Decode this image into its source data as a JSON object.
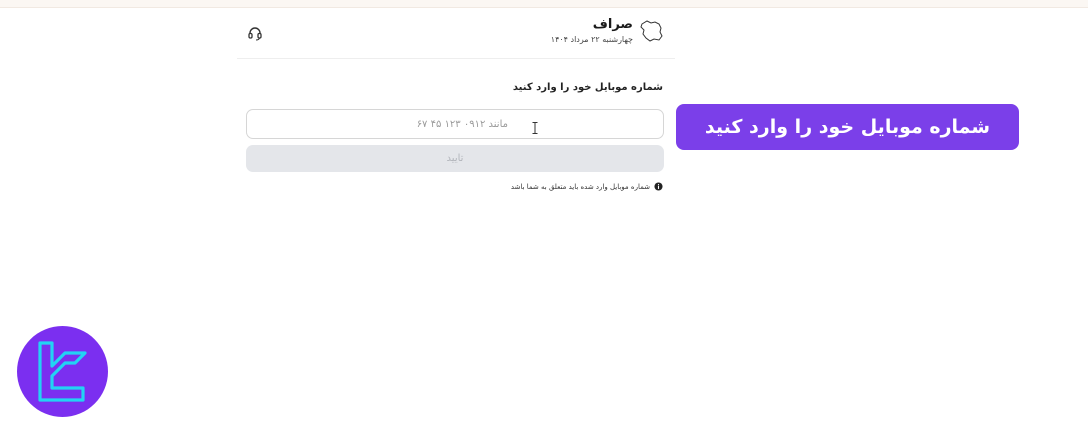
{
  "header": {
    "brand_name": "صراف",
    "brand_date": "چهارشنبه ۲۲ مرداد ۱۴۰۴",
    "brand_icon": "iran-map-icon",
    "support_icon": "headset-icon"
  },
  "login": {
    "title": "شماره موبایل خود را وارد کنید",
    "phone_value": "",
    "phone_placeholder": "مانند ۰۹۱۲ ۱۲۳ ۴۵ ۶۷",
    "confirm_label": "تایید",
    "hint": "شماره موبایل وارد شده باید متعلق به شما باشد",
    "hint_icon": "info-icon"
  },
  "callout": {
    "text": "شماره موبایل خود را وارد کنید"
  },
  "colors": {
    "accent": "#7b3fe9",
    "button_disabled_bg": "#e4e6ea",
    "button_disabled_text": "#b3b6bc",
    "logo_ring": "#22d3f4"
  }
}
